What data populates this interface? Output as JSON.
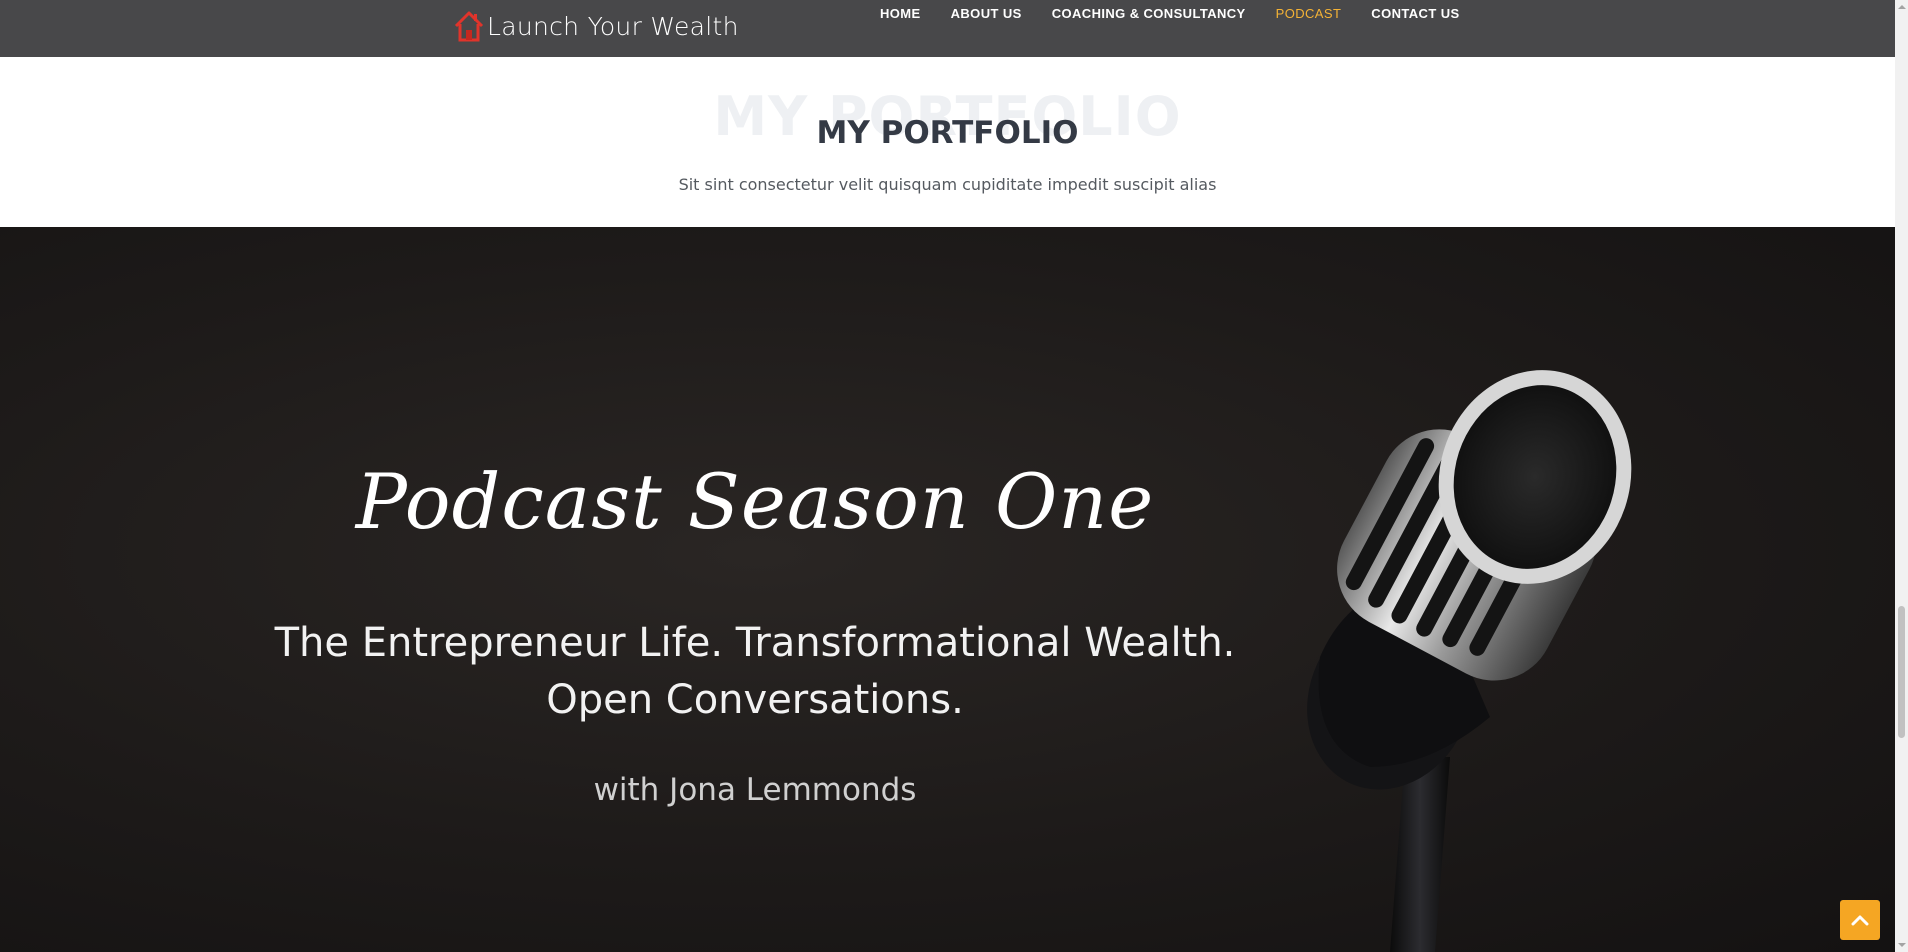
{
  "brand": {
    "name": "Launch Your Wealth",
    "accent": "#f5b335",
    "logo_icon": "house-icon"
  },
  "nav": {
    "items": [
      {
        "label": "HOME"
      },
      {
        "label": "ABOUT US"
      },
      {
        "label": "COACHING & CONSULTANCY"
      },
      {
        "label": "PODCAST"
      },
      {
        "label": "CONTACT US"
      }
    ],
    "active": "PODCAST"
  },
  "section": {
    "watermark": "MY PORTFOLIO",
    "title": "MY PORTFOLIO",
    "subtitle": "Sit sint consectetur velit quisquam cupiditate impedit suscipit alias"
  },
  "hero": {
    "title": "Podcast Season One",
    "line1": "The Entrepreneur Life. Transformational Wealth.",
    "line2": "Open Conversations.",
    "host": "with Jona Lemmonds",
    "image": "microphone"
  },
  "back_to_top": {
    "icon": "chevron-up-icon",
    "color": "#f5a623"
  }
}
